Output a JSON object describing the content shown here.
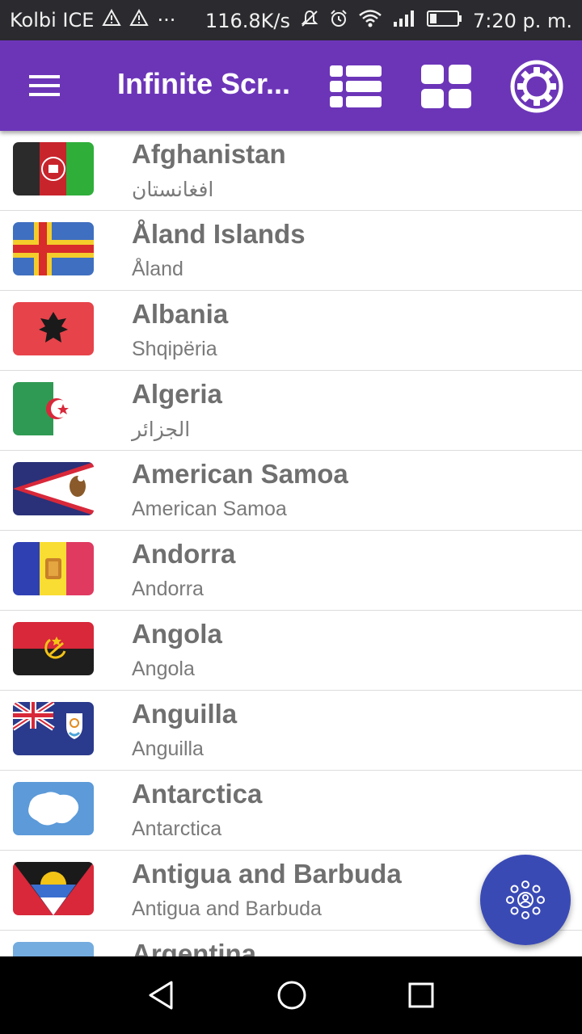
{
  "status_bar": {
    "carrier": "Kolbi ICE",
    "more": "···",
    "speed": "116.8K/s",
    "time": "7:20 p. m.",
    "icons": [
      "warning-icon",
      "warning-icon",
      "mute-icon",
      "alarm-icon",
      "wifi-icon",
      "signal-icon",
      "battery-icon"
    ]
  },
  "app_bar": {
    "title": "Infinite Scr...",
    "color": "#6c35b8",
    "actions": [
      "list-view-icon",
      "grid-view-icon",
      "settings-icon"
    ]
  },
  "countries": [
    {
      "name": "Afghanistan",
      "native": "افغانستان",
      "flag": "afghanistan-flag"
    },
    {
      "name": "Åland Islands",
      "native": "Åland",
      "flag": "aland-islands-flag"
    },
    {
      "name": "Albania",
      "native": "Shqipëria",
      "flag": "albania-flag"
    },
    {
      "name": "Algeria",
      "native": "الجزائر",
      "flag": "algeria-flag"
    },
    {
      "name": "American Samoa",
      "native": "American Samoa",
      "flag": "american-samoa-flag"
    },
    {
      "name": "Andorra",
      "native": "Andorra",
      "flag": "andorra-flag"
    },
    {
      "name": "Angola",
      "native": "Angola",
      "flag": "angola-flag"
    },
    {
      "name": "Anguilla",
      "native": "Anguilla",
      "flag": "anguilla-flag"
    },
    {
      "name": "Antarctica",
      "native": "Antarctica",
      "flag": "antarctica-flag"
    },
    {
      "name": "Antigua and Barbuda",
      "native": "Antigua and Barbuda",
      "flag": "antigua-and-barbuda-flag"
    },
    {
      "name": "Argentina",
      "native": "",
      "flag": "argentina-flag"
    }
  ],
  "fab": {
    "icon": "people-network-icon",
    "color": "#3a4ab5"
  },
  "nav_bar": {
    "buttons": [
      "back-icon",
      "home-icon",
      "recents-icon"
    ]
  }
}
